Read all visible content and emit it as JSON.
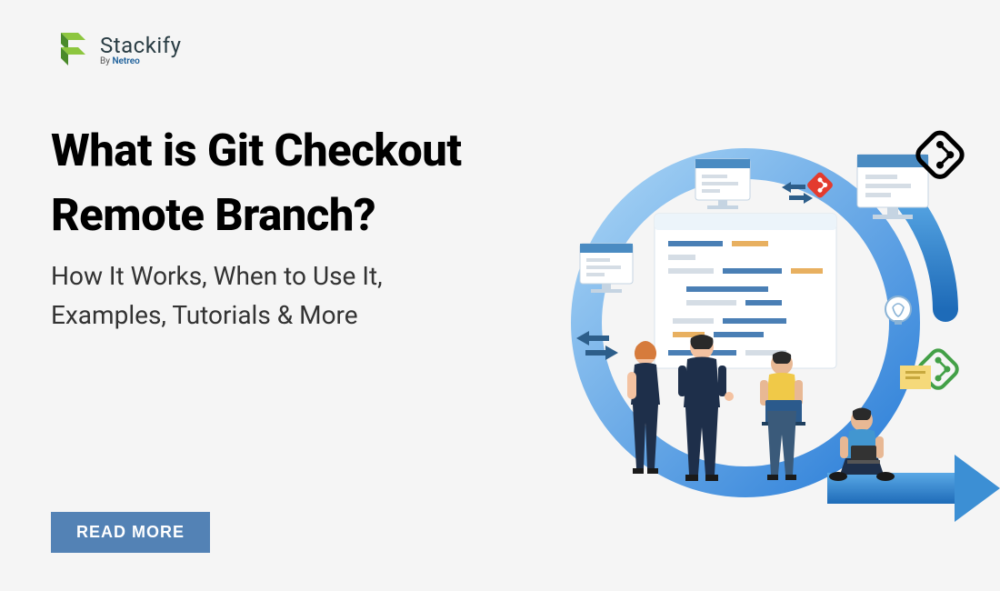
{
  "logo": {
    "name": "Stackify",
    "byline_prefix": "By ",
    "byline_brand": "Netreo"
  },
  "heading_line1": "What is Git Checkout",
  "heading_line2": "Remote Branch?",
  "subheading_line1": "How It Works, When to Use It,",
  "subheading_line2": "Examples, Tutorials & More",
  "cta_label": "READ MORE"
}
